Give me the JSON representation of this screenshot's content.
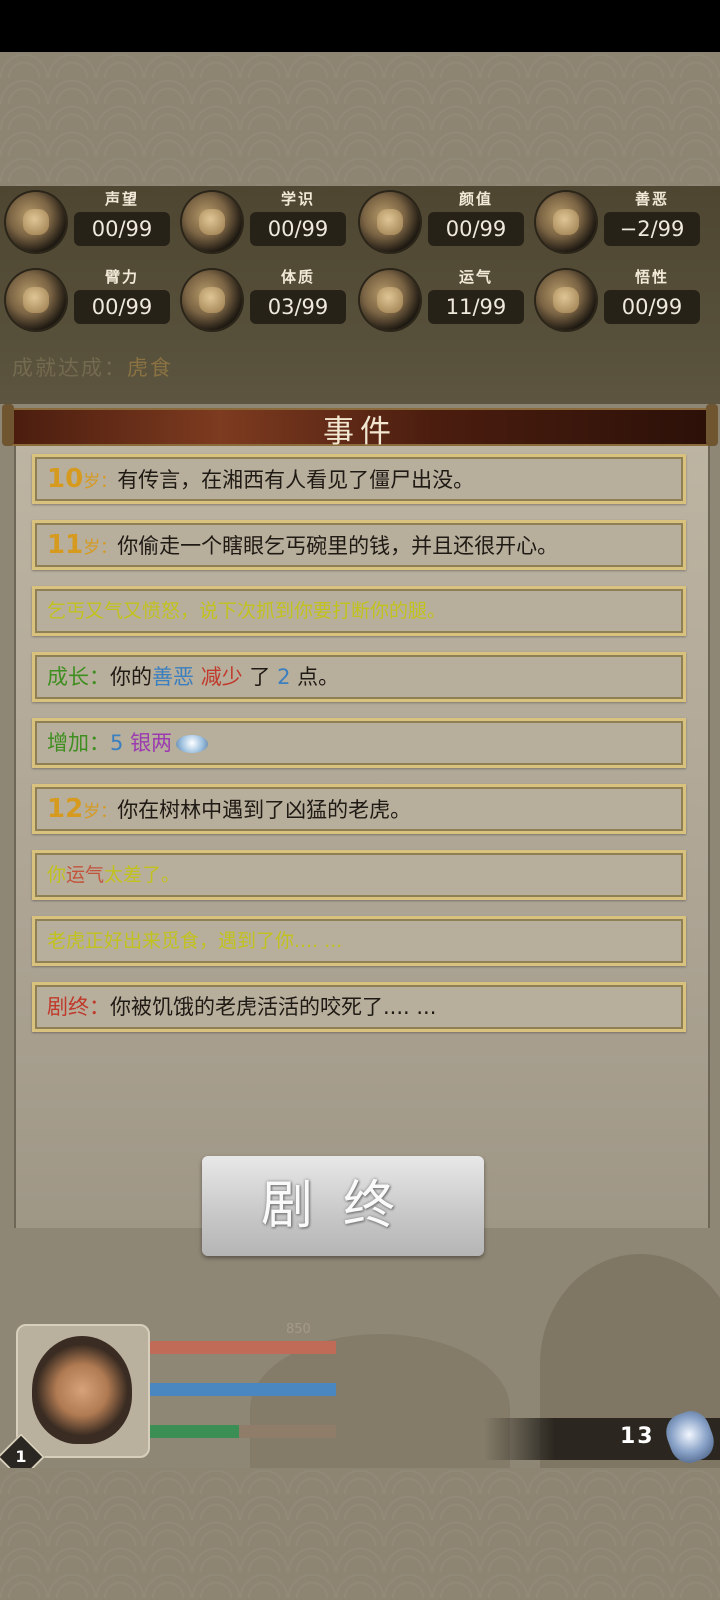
{
  "stats": [
    {
      "label": "声望",
      "value": "00/99",
      "icon": "fame-icon"
    },
    {
      "label": "学识",
      "value": "00/99",
      "icon": "knowledge-icon"
    },
    {
      "label": "颜值",
      "value": "00/99",
      "icon": "looks-icon"
    },
    {
      "label": "善恶",
      "value": "−2/99",
      "icon": "morality-icon"
    },
    {
      "label": "臂力",
      "value": "00/99",
      "icon": "strength-icon"
    },
    {
      "label": "体质",
      "value": "03/99",
      "icon": "constitution-icon"
    },
    {
      "label": "运气",
      "value": "11/99",
      "icon": "luck-icon"
    },
    {
      "label": "悟性",
      "value": "00/99",
      "icon": "comprehension-icon"
    }
  ],
  "achievement": {
    "label": "成就达成：",
    "value": "虎食"
  },
  "panel": {
    "title": "事件"
  },
  "events": {
    "e1": {
      "age": "10",
      "suffix": "岁：",
      "text": "有传言，在湘西有人看见了僵尸出没。"
    },
    "e2": {
      "age": "11",
      "suffix": "岁：",
      "text": "你偷走一个瞎眼乞丐碗里的钱，并且还很开心。"
    },
    "e3": {
      "text": "乞丐又气又愤怒，说下次抓到你要打断你的腿。"
    },
    "e4": {
      "prefix": "成长：",
      "p1": "你的",
      "attr": "善恶",
      "change": "减少",
      "p2": "了",
      "amount": "2",
      "p3": "点。"
    },
    "e5": {
      "prefix": "增加：",
      "amount": "5",
      "item": "银两"
    },
    "e6": {
      "age": "12",
      "suffix": "岁：",
      "text": "你在树林中遇到了凶猛的老虎。"
    },
    "e7": {
      "p1": "你",
      "hl": "运气",
      "p2": "太差了。"
    },
    "e8": {
      "text": "老虎正好出来觅食，遇到了你.... ..."
    },
    "e9": {
      "prefix": "剧终：",
      "text": "你被饥饿的老虎活活的咬死了.... ..."
    }
  },
  "end_button": {
    "label": "剧终"
  },
  "player": {
    "level": "1",
    "hp_value": "850",
    "bars": [
      {
        "name": "hp",
        "fill": 1.0,
        "color": "#c06b58"
      },
      {
        "name": "mp",
        "fill": 1.0,
        "color": "#4a86c0"
      },
      {
        "name": "sp",
        "fill": 0.48,
        "color": "#3b8f55"
      }
    ]
  },
  "currency": {
    "count": "13",
    "icon": "silver-ingot-icon"
  }
}
